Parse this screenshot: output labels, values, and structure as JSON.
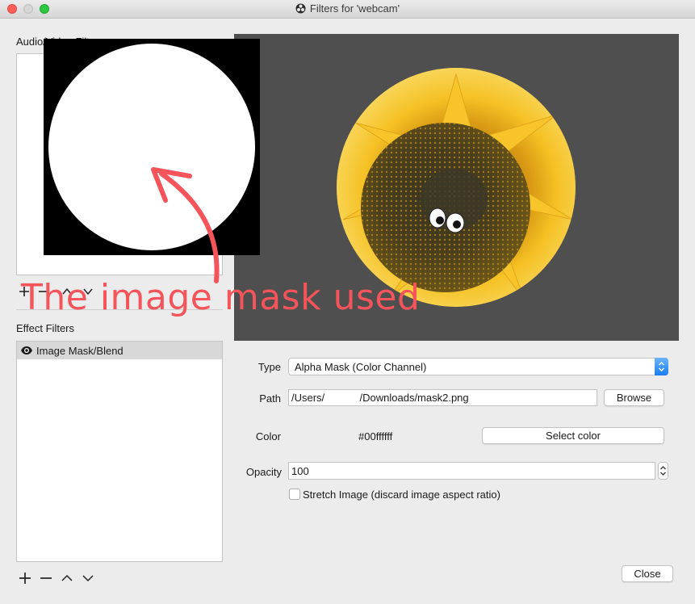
{
  "window": {
    "title": "Filters for 'webcam'"
  },
  "audio_video_filters": {
    "label": "Audio/Video Filters"
  },
  "effect_filters": {
    "label": "Effect Filters",
    "items": [
      {
        "label": "Image Mask/Blend",
        "icon": "eye-icon",
        "selected": true
      }
    ]
  },
  "form": {
    "type_label": "Type",
    "type_value": "Alpha Mask (Color Channel)",
    "path_label": "Path",
    "path_value": "/Users/            /Downloads/mask2.png",
    "browse_label": "Browse",
    "color_label": "Color",
    "color_value": "#00ffffff",
    "select_color_label": "Select color",
    "opacity_label": "Opacity",
    "opacity_value": "100",
    "stretch_label": "Stretch Image (discard image aspect ratio)",
    "stretch_checked": false
  },
  "footer": {
    "close_label": "Close"
  },
  "annotation": {
    "text": "The image mask used",
    "color": "#f4545a"
  },
  "colors": {
    "preview_bg": "#4f4f4f",
    "close_dot": "#fc5f57",
    "max_dot": "#2bc840",
    "select_accent": "#1a7ef5"
  }
}
